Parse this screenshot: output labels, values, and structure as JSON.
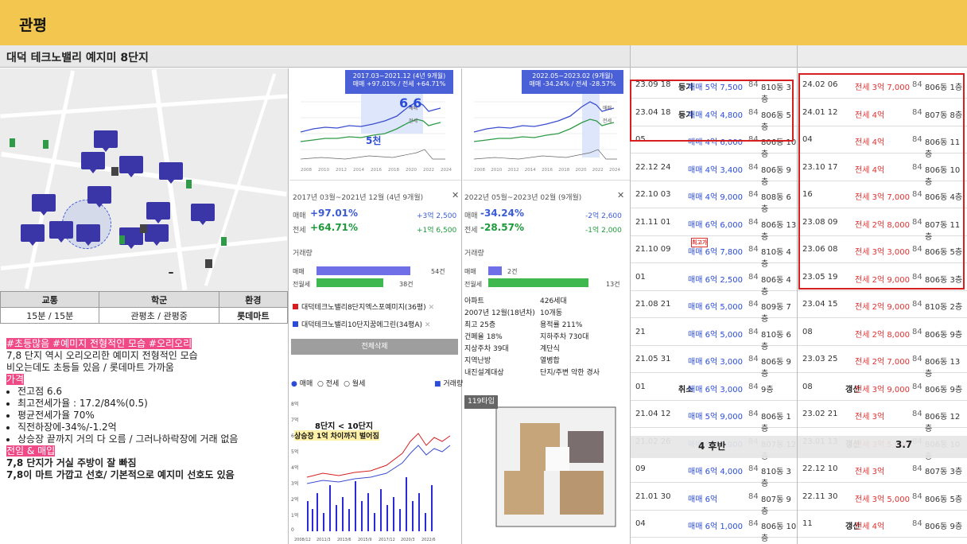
{
  "header": {
    "title": "관평"
  },
  "property": {
    "title": "대덕 테크노밸리 예지미 8단지"
  },
  "info": {
    "headers": [
      "교통",
      "학군",
      "환경"
    ],
    "values": [
      "15분 / 15분",
      "관평초 / 관평중",
      "롯데마트"
    ]
  },
  "notes": {
    "tag1": "#초등많음 #예미지 전형적인 모습 #오리오리",
    "line1": "7,8 단지 역시 오리오리한 예미지 전형적인 모습",
    "line2": "비오는데도 초등들 있음 / 롯데마트 가까움",
    "tag2": "가격",
    "bullets": [
      "전고점 6.6",
      "최고전세가율 : 17.2/84%(0.5)",
      "평균전세가율 70%",
      "직전하장에-34%/-1.2억",
      "상승장 끝까지 거의 다 오름 / 그러나하락장에 거래 없음"
    ],
    "tag3": "전임 & 매입",
    "line3": "7,8 단지가 거실 주방이 잘 빠짐",
    "line4": "7,8이 마트 가깝고 선호/ 기본적으로 예지미 선호도 있음"
  },
  "chart1": {
    "box_l1": "2017.03~2021.12 (4년 9개월)",
    "box_l2": "매매 +97.01% / 전세 +64.71%",
    "annot_high": "6.6",
    "annot_low": "5천",
    "years": [
      "2008",
      "2010",
      "2012",
      "2014",
      "2016",
      "2018",
      "2020",
      "2022",
      "2024"
    ],
    "period": "2017년 03월~2021년 12월 (4년 9개월)",
    "sale_label": "매매",
    "sale_pct": "+97.01%",
    "sale_amt": "+3억 2,500",
    "rent_label": "전세",
    "rent_pct": "+64.71%",
    "rent_amt": "+1억 6,500",
    "vol_title": "거래량",
    "vol_sale": "54건",
    "vol_rent": "38건",
    "vol_sale_frac": 0.84,
    "vol_rent_frac": 0.6
  },
  "chart2": {
    "box_l1": "2022.05~2023.02 (9개월)",
    "box_l2": "매매 -34.24% / 전세 -28.57%",
    "years": [
      "2008",
      "2010",
      "2012",
      "2014",
      "2016",
      "2018",
      "2020",
      "2022",
      "2024"
    ],
    "period": "2022년 05월~2023년 02월 (9개월)",
    "sale_label": "매매",
    "sale_pct": "-34.24%",
    "sale_amt": "-2억 2,600",
    "rent_label": "전세",
    "rent_pct": "-28.57%",
    "rent_amt": "-1억 2,000",
    "vol_title": "거래량",
    "vol_sale": "2건",
    "vol_rent": "13건",
    "vol_sale_frac": 0.12,
    "vol_rent_frac": 0.9
  },
  "legend": {
    "a": "대덕테크노밸리8단지엑스포예미지(36평)",
    "b": "대덕테크노밸리10단지꿈에그린(34평A)",
    "button": "전체삭제",
    "radio": [
      "매매",
      "전세",
      "월세"
    ],
    "checkbox": "거래량",
    "annot1": "8단지 < 10단지",
    "annot2": "상승장 1억 차이까지 벌어짐",
    "yticks": [
      "8억",
      "7억",
      "6억",
      "5억",
      "4억",
      "3억",
      "2억",
      "1억",
      "0"
    ],
    "xticks": [
      "2008/12",
      "2011/3",
      "2013/6",
      "2015/9",
      "2017/12",
      "2020/3",
      "2022/6"
    ]
  },
  "facts": {
    "left": [
      "아파트",
      "2007년 12월(18년차)",
      "최고 25층",
      "건폐율 18%",
      "지상주차 39대",
      "지역난방",
      "내진설계대상"
    ],
    "right": [
      "426세대",
      "10개동",
      "용적률 211%",
      "지하주차 730대",
      "계단식",
      "열병합",
      "단지/주변 악한 경사"
    ],
    "type": "119타입"
  },
  "trades_sale": [
    {
      "d": "23.09",
      "dd": "18",
      "flag": "등기",
      "p": "매매 5억 7,500",
      "a": "84",
      "u": "810동 3층"
    },
    {
      "d": "23.04",
      "dd": "18",
      "flag": "등기",
      "p": "매매 4억 4,800",
      "a": "84",
      "u": "806동 5층"
    },
    {
      "d": "",
      "dd": "05",
      "flag": "",
      "p": "매매 4억 6,000",
      "a": "84",
      "u": "806동 10층"
    },
    {
      "d": "22.12",
      "dd": "24",
      "flag": "",
      "p": "매매 4억 3,400",
      "a": "84",
      "u": "806동 9층"
    },
    {
      "d": "22.10",
      "dd": "03",
      "flag": "",
      "p": "매매 4억 9,000",
      "a": "84",
      "u": "808동 6층"
    },
    {
      "d": "21.11",
      "dd": "01",
      "flag": "",
      "p": "매매 6억 6,000",
      "a": "84",
      "u": "806동 13층"
    },
    {
      "d": "21.10",
      "dd": "09",
      "flag": "최고가",
      "p": "매매 6억 7,800",
      "a": "84",
      "u": "810동 4층"
    },
    {
      "d": "",
      "dd": "01",
      "flag": "",
      "p": "매매 6억 2,500",
      "a": "84",
      "u": "806동 4층"
    },
    {
      "d": "21.08",
      "dd": "21",
      "flag": "",
      "p": "매매 6억 5,000",
      "a": "84",
      "u": "809동 7층"
    },
    {
      "d": "",
      "dd": "21",
      "flag": "",
      "p": "매매 6억 5,000",
      "a": "84",
      "u": "810동 6층"
    },
    {
      "d": "21.05",
      "dd": "31",
      "flag": "",
      "p": "매매 6억 3,000",
      "a": "84",
      "u": "806동 9층"
    },
    {
      "d": "",
      "dd": "01",
      "flag": "취소",
      "p": "매매 6억 3,000",
      "a": "84",
      "u": "9층"
    },
    {
      "d": "21.04",
      "dd": "12",
      "flag": "",
      "p": "매매 5억 9,000",
      "a": "84",
      "u": "806동 1층"
    },
    {
      "d": "21.02",
      "dd": "26",
      "flag": "",
      "p": "매매 6억 5,000",
      "a": "84",
      "u": "807동 12층"
    },
    {
      "d": "",
      "dd": "09",
      "flag": "",
      "p": "매매 6억 4,000",
      "a": "84",
      "u": "810동 3층"
    },
    {
      "d": "21.01",
      "dd": "30",
      "flag": "",
      "p": "매매 6억",
      "a": "84",
      "u": "807동 9층"
    },
    {
      "d": "",
      "dd": "04",
      "flag": "",
      "p": "매매 6억 1,000",
      "a": "84",
      "u": "806동 10층"
    }
  ],
  "trades_rent": [
    {
      "d": "24.02",
      "dd": "06",
      "flag": "",
      "p": "전세 3억 7,000",
      "a": "84",
      "u": "806동 1층"
    },
    {
      "d": "24.01",
      "dd": "12",
      "flag": "",
      "p": "전세 4억",
      "a": "84",
      "u": "807동 8층"
    },
    {
      "d": "",
      "dd": "04",
      "flag": "",
      "p": "전세 4억",
      "a": "84",
      "u": "806동 11층"
    },
    {
      "d": "23.10",
      "dd": "17",
      "flag": "",
      "p": "전세 4억",
      "a": "84",
      "u": "806동 10층"
    },
    {
      "d": "",
      "dd": "16",
      "flag": "",
      "p": "전세 3억 7,000",
      "a": "84",
      "u": "806동 4층"
    },
    {
      "d": "23.08",
      "dd": "09",
      "flag": "",
      "p": "전세 2억 8,000",
      "a": "84",
      "u": "807동 11층"
    },
    {
      "d": "23.06",
      "dd": "08",
      "flag": "",
      "p": "전세 3억 3,000",
      "a": "84",
      "u": "806동 5층"
    },
    {
      "d": "23.05",
      "dd": "19",
      "flag": "",
      "p": "전세 2억 9,000",
      "a": "84",
      "u": "806동 3층"
    },
    {
      "d": "23.04",
      "dd": "15",
      "flag": "",
      "p": "전세 2억 9,000",
      "a": "84",
      "u": "810동 2층"
    },
    {
      "d": "",
      "dd": "08",
      "flag": "",
      "p": "전세 2억 8,000",
      "a": "84",
      "u": "806동 9층"
    },
    {
      "d": "23.03",
      "dd": "25",
      "flag": "",
      "p": "전세 2억 7,000",
      "a": "84",
      "u": "806동 13층"
    },
    {
      "d": "",
      "dd": "08",
      "flag": "갱신",
      "p": "전세 3억 9,000",
      "a": "84",
      "u": "806동 9층"
    },
    {
      "d": "23.02",
      "dd": "21",
      "flag": "",
      "p": "전세 3억",
      "a": "84",
      "u": "806동 12층"
    },
    {
      "d": "23.01",
      "dd": "13",
      "flag": "갱신",
      "p": "전세 3억 5,000",
      "a": "84",
      "u": "806동 10층"
    },
    {
      "d": "22.12",
      "dd": "10",
      "flag": "",
      "p": "전세 3억",
      "a": "84",
      "u": "807동 3층"
    },
    {
      "d": "22.11",
      "dd": "30",
      "flag": "",
      "p": "전세 3억 5,000",
      "a": "84",
      "u": "806동 5층"
    },
    {
      "d": "",
      "dd": "11",
      "flag": "갱신",
      "p": "전세 4억",
      "a": "84",
      "u": "806동 9층"
    }
  ],
  "overlay": {
    "sale": "4 후반",
    "rent": "3.7"
  }
}
